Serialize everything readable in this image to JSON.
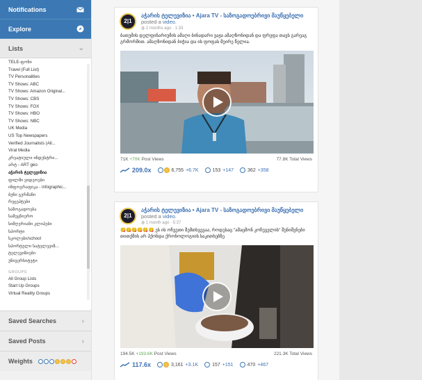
{
  "sidebar": {
    "notifications": "Notifications",
    "explore": "Explore",
    "lists": "Lists",
    "list_items": [
      "TELE-ფონი",
      "Travel (Full List)",
      "TV Personalities",
      "TV Shows: ABC",
      "TV Shows: Amazon Original...",
      "TV Shows: CBS",
      "TV Shows: FOX",
      "TV Shows: HBO",
      "TV Shows: NBC",
      "UK Media",
      "US Top Newspapers",
      "Verified Journalists (All...",
      "Viral Media",
      "კრეატიული ინდუსტრი...",
      "არტ - ART geo",
      "აჭარის ტელევიზია",
      "ფილმი ვიდეოები",
      "ინფოგრაფიკა - infographic...",
      "ბუნი გურმანი",
      "რეცეპტები",
      "საზოგადოება",
      "სამეცნიერო",
      "სიმღერიანი კლიპები",
      "სპორტი",
      "სკოლები/school",
      "სპორტული სატელევიზ...",
      "ტელევიზიები",
      "უნივერსიტეტი"
    ],
    "active_item": "აჭარის ტელევიზია",
    "groups_label": "GROUPS",
    "group_items": [
      "All Group Lists",
      "Start Up Groups",
      "Virtual Reality Groups"
    ],
    "saved_searches": "Saved Searches",
    "saved_posts": "Saved Posts",
    "weights": "Weights"
  },
  "posts": [
    {
      "page_name": "აჭარის ტელევიზია • Ajara TV - საზოგადოებრივი მაუწყებელი",
      "posted_prefix": "posted a",
      "posted_link": "video.",
      "meta": "2 months ago · 1:33",
      "text": "ბათუმის დელფინარიუმის ამაღი ბინადარი ვაჟა ამაღზონიდან და ფრეფა თავს გარეაგ გრმორმით. ამაღზონიდან ბიჭია და ის ფოფას მეირე წელია.",
      "views_text": "71K",
      "views_delta": "+70K",
      "views_label": "Post Views",
      "total_views": "77.8K Total Views",
      "engagement": "209.0x",
      "reactions": "6,755",
      "reactions_delta": "+6.7K",
      "comments": "153",
      "comments_delta": "+147",
      "shares": "362",
      "shares_delta": "+358"
    },
    {
      "page_name": "აჭარის ტელევიზია • Ajara TV - საზოგადოებრივი მაუწყებელი",
      "posted_prefix": "posted a",
      "posted_link": "video.",
      "meta": "1 month ago · 5:37",
      "text": "ეს ის ოჩვეთი შემთხვევაა, როდესაც \"ამაცმონ კოჩეველის\" შენიშვნები თითქმის არ ჰქონდა ქრონოლოგიის საკითხებზე",
      "views_text": "194.5K",
      "views_delta": "+193.6K",
      "views_label": "Post Views",
      "total_views": "221.3K Total Views",
      "engagement": "117.6x",
      "reactions": "3,161",
      "reactions_delta": "+3.1K",
      "comments": "157",
      "comments_delta": "+151",
      "shares": "470",
      "shares_delta": "+467"
    }
  ],
  "colors": {
    "accent": "#3b78b4",
    "link": "#3b6fb0",
    "positive": "#5aa84e"
  }
}
